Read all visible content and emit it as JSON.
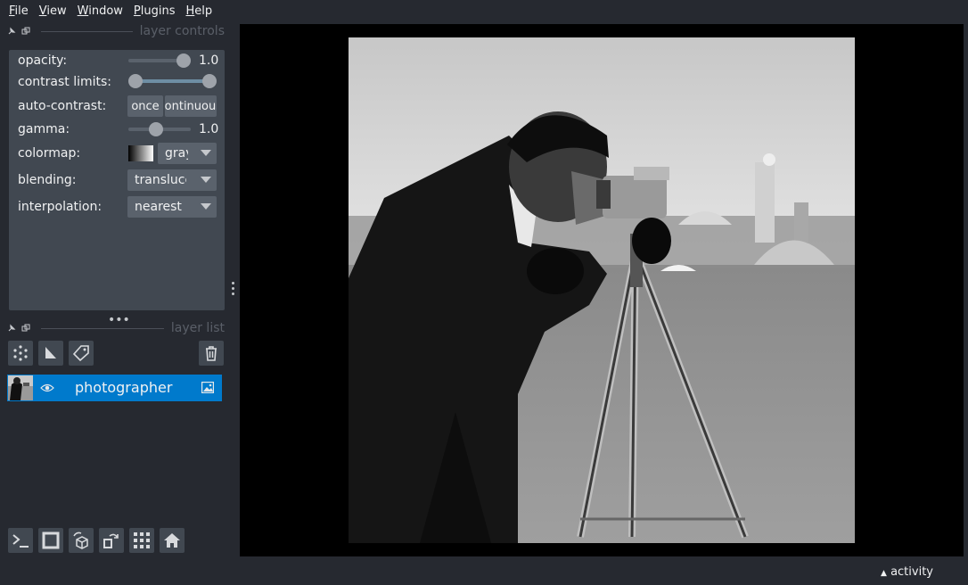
{
  "menu": {
    "items": [
      {
        "mn": "F",
        "rest": "ile"
      },
      {
        "mn": "V",
        "rest": "iew"
      },
      {
        "mn": "W",
        "rest": "indow"
      },
      {
        "mn": "P",
        "rest": "lugins"
      },
      {
        "mn": "H",
        "rest": "elp"
      }
    ]
  },
  "layer_controls": {
    "title": "layer controls",
    "opacity": {
      "label": "opacity:",
      "value": "1.0",
      "level": 1.0
    },
    "contrast_limits": {
      "label": "contrast limits:",
      "low": 0.0,
      "high": 1.0
    },
    "auto_contrast": {
      "label": "auto-contrast:",
      "once": "once",
      "continuous": "continuous"
    },
    "gamma": {
      "label": "gamma:",
      "value": "1.0",
      "level": 0.5
    },
    "colormap": {
      "label": "colormap:",
      "value": "gray"
    },
    "blending": {
      "label": "blending:",
      "value": "translucent"
    },
    "interpolation": {
      "label": "interpolation:",
      "value": "nearest"
    }
  },
  "layer_list": {
    "title": "layer list",
    "layers": [
      {
        "name": "photographer",
        "visible": true,
        "type": "image"
      }
    ]
  },
  "status": {
    "activity": "activity"
  },
  "colors": {
    "background": "#262930",
    "panel": "#414851",
    "control": "#5a626c",
    "selected": "#007acc",
    "text": "#f0f1f2"
  },
  "icons": {
    "dock_controls": [
      "pin-icon",
      "float-icon"
    ],
    "layer_buttons": [
      "new-points-icon",
      "new-shapes-icon",
      "new-labels-icon",
      "delete-icon"
    ],
    "viewer_buttons": [
      "console-icon",
      "ndisplay-icon",
      "roll-icon",
      "transpose-icon",
      "grid-icon",
      "home-icon"
    ]
  }
}
